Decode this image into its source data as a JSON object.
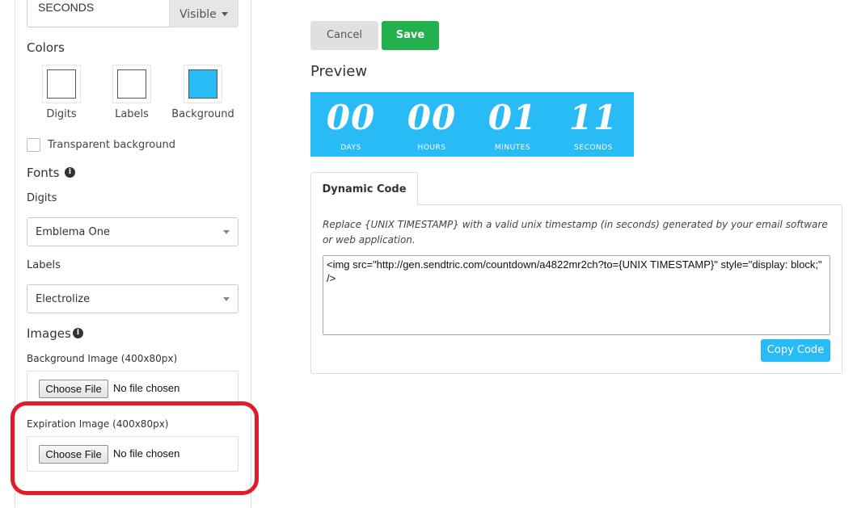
{
  "labels_field": {
    "value": "SECONDS",
    "visibility": "Visible"
  },
  "colors": {
    "title": "Colors",
    "swatches": [
      {
        "label": "Digits",
        "color": "#ffffff"
      },
      {
        "label": "Labels",
        "color": "#ffffff"
      },
      {
        "label": "Background",
        "color": "#29bbf6"
      }
    ],
    "transparent_label": "Transparent background"
  },
  "fonts": {
    "title": "Fonts",
    "digits_label": "Digits",
    "digits_value": "Emblema One",
    "labels_label": "Labels",
    "labels_value": "Electrolize"
  },
  "images": {
    "title": "Images",
    "background_label": "Background Image (400x80px)",
    "expiration_label": "Expiration Image (400x80px)",
    "choose_file": "Choose File",
    "no_file": "No file chosen"
  },
  "actions": {
    "cancel": "Cancel",
    "save": "Save"
  },
  "preview": {
    "title": "Preview",
    "units": [
      {
        "digits": "00",
        "label": "DAYS"
      },
      {
        "digits": "00",
        "label": "HOURS"
      },
      {
        "digits": "01",
        "label": "MINUTES"
      },
      {
        "digits": "11",
        "label": "SECONDS"
      }
    ]
  },
  "code": {
    "tab": "Dynamic Code",
    "help": "Replace {UNIX TIMESTAMP} with a valid unix timestamp (in seconds) generated by your email software or web application.",
    "snippet": "<img src=\"http://gen.sendtric.com/countdown/a4822mr2ch?to={UNIX TIMESTAMP}\" style=\"display: block;\" />",
    "copy_label": "Copy Code"
  },
  "theme": {
    "accent": "#29bbf6",
    "save": "#23b14d",
    "highlight": "#e21b2a"
  }
}
